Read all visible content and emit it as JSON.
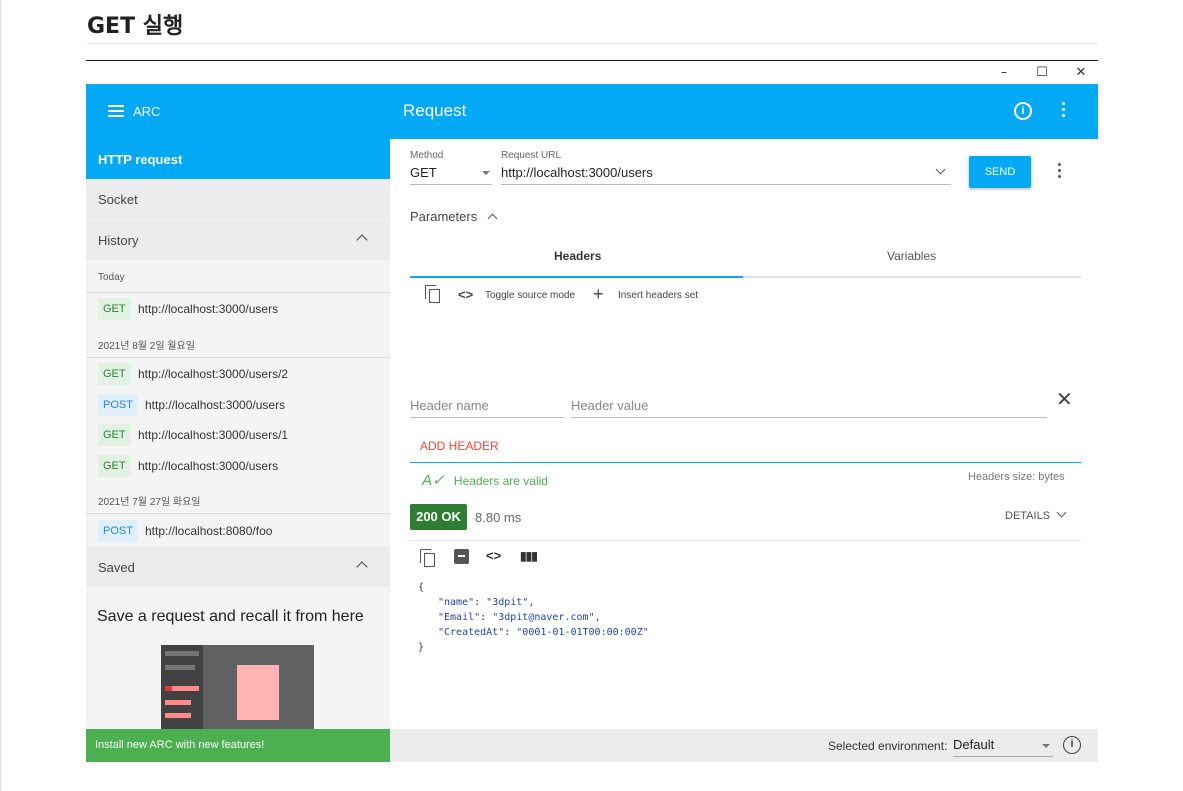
{
  "page": {
    "heading": "GET 실행"
  },
  "window": {
    "minimize": "–",
    "maximize": "☐",
    "close": "✕"
  },
  "app_header": {
    "app_name": "ARC",
    "title": "Request",
    "info_glyph": "i"
  },
  "sidebar": {
    "active_item": "HTTP request",
    "socket": "Socket",
    "history": "History",
    "saved": "Saved",
    "groups": [
      {
        "date": "Today",
        "items": [
          {
            "method": "GET",
            "url": "http://localhost:3000/users"
          }
        ]
      },
      {
        "date": "2021년 8월 2일 월요일",
        "items": [
          {
            "method": "GET",
            "url": "http://localhost:3000/users/2"
          },
          {
            "method": "POST",
            "url": "http://localhost:3000/users"
          },
          {
            "method": "GET",
            "url": "http://localhost:3000/users/1"
          },
          {
            "method": "GET",
            "url": "http://localhost:3000/users"
          }
        ]
      },
      {
        "date": "2021년 7월 27일 화요일",
        "items": [
          {
            "method": "POST",
            "url": "http://localhost:8080/foo"
          }
        ]
      }
    ],
    "saved_empty_title": "Save a request and recall it from here",
    "install_banner": "Install new ARC with new features!"
  },
  "request": {
    "method_label": "Method",
    "method_value": "GET",
    "url_label": "Request URL",
    "url_value": "http://localhost:3000/users",
    "send_label": "SEND",
    "parameters_label": "Parameters",
    "tabs": [
      {
        "label": "Headers",
        "active": true
      },
      {
        "label": "Variables",
        "active": false
      }
    ],
    "toggle_source": "Toggle source mode",
    "insert_headers": "Insert headers set",
    "header_name_placeholder": "Header name",
    "header_value_placeholder": "Header value",
    "add_header": "ADD HEADER",
    "headers_valid": "Headers are valid",
    "headers_size": "Headers size: bytes"
  },
  "response": {
    "status": "200 OK",
    "timing": "8.80 ms",
    "details": "DETAILS",
    "json_lines": [
      {
        "text": "{"
      },
      {
        "key": "\"name\"",
        "value": "\"3dpit\","
      },
      {
        "key": "\"Email\"",
        "value": "\"3dpit@naver.com\","
      },
      {
        "key": "\"CreatedAt\"",
        "value": "\"0001-01-01T00:00:00Z\""
      },
      {
        "text": "}"
      }
    ]
  },
  "footer": {
    "env_label": "Selected environment:",
    "env_value": "Default"
  },
  "colors": {
    "accent": "#03a9f4",
    "status_ok": "#2e7d32",
    "install": "#4caf50",
    "add_header": "#f44336"
  }
}
